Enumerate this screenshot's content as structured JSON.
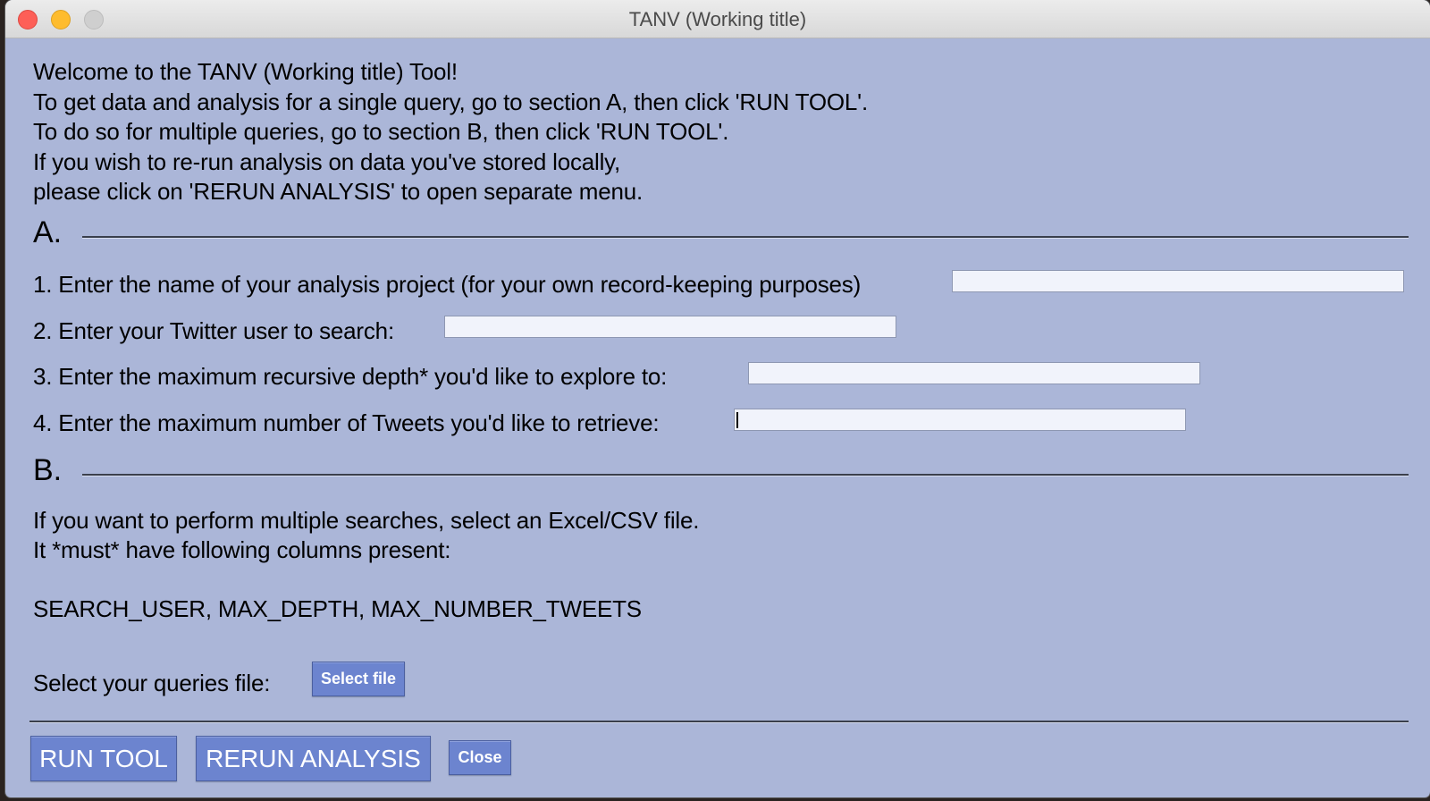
{
  "window": {
    "title": "TANV (Working title)"
  },
  "intro": {
    "lines": [
      "Welcome to the TANV (Working title) Tool!",
      "To get data and analysis for a single query, go to section A, then click 'RUN TOOL'.",
      "To do so for multiple queries, go to section B, then click 'RUN TOOL'.",
      "If you wish to re-run analysis on data you've stored locally,",
      "please click on 'RERUN ANALYSIS' to open separate menu."
    ]
  },
  "section_a": {
    "label": "A.",
    "fields": [
      {
        "label": "1. Enter the name of your analysis project (for your own record-keeping purposes)",
        "value": ""
      },
      {
        "label": "2. Enter your Twitter user to search:",
        "value": ""
      },
      {
        "label": "3. Enter the maximum recursive depth* you'd like to explore to:",
        "value": ""
      },
      {
        "label": "4. Enter the maximum number of Tweets you'd like to retrieve:",
        "value": ""
      }
    ]
  },
  "section_b": {
    "label": "B.",
    "line1": "If you want to perform multiple searches, select an Excel/CSV file.",
    "line2": "It *must* have following columns present:",
    "columns": "SEARCH_USER, MAX_DEPTH, MAX_NUMBER_TWEETS",
    "file_label": "Select your queries file:",
    "select_button": "Select file"
  },
  "footer": {
    "run_button": "RUN TOOL",
    "rerun_button": "RERUN ANALYSIS",
    "close_button": "Close"
  },
  "colors": {
    "window_bg": "#abb6d8",
    "button_bg": "#6c84cf"
  }
}
